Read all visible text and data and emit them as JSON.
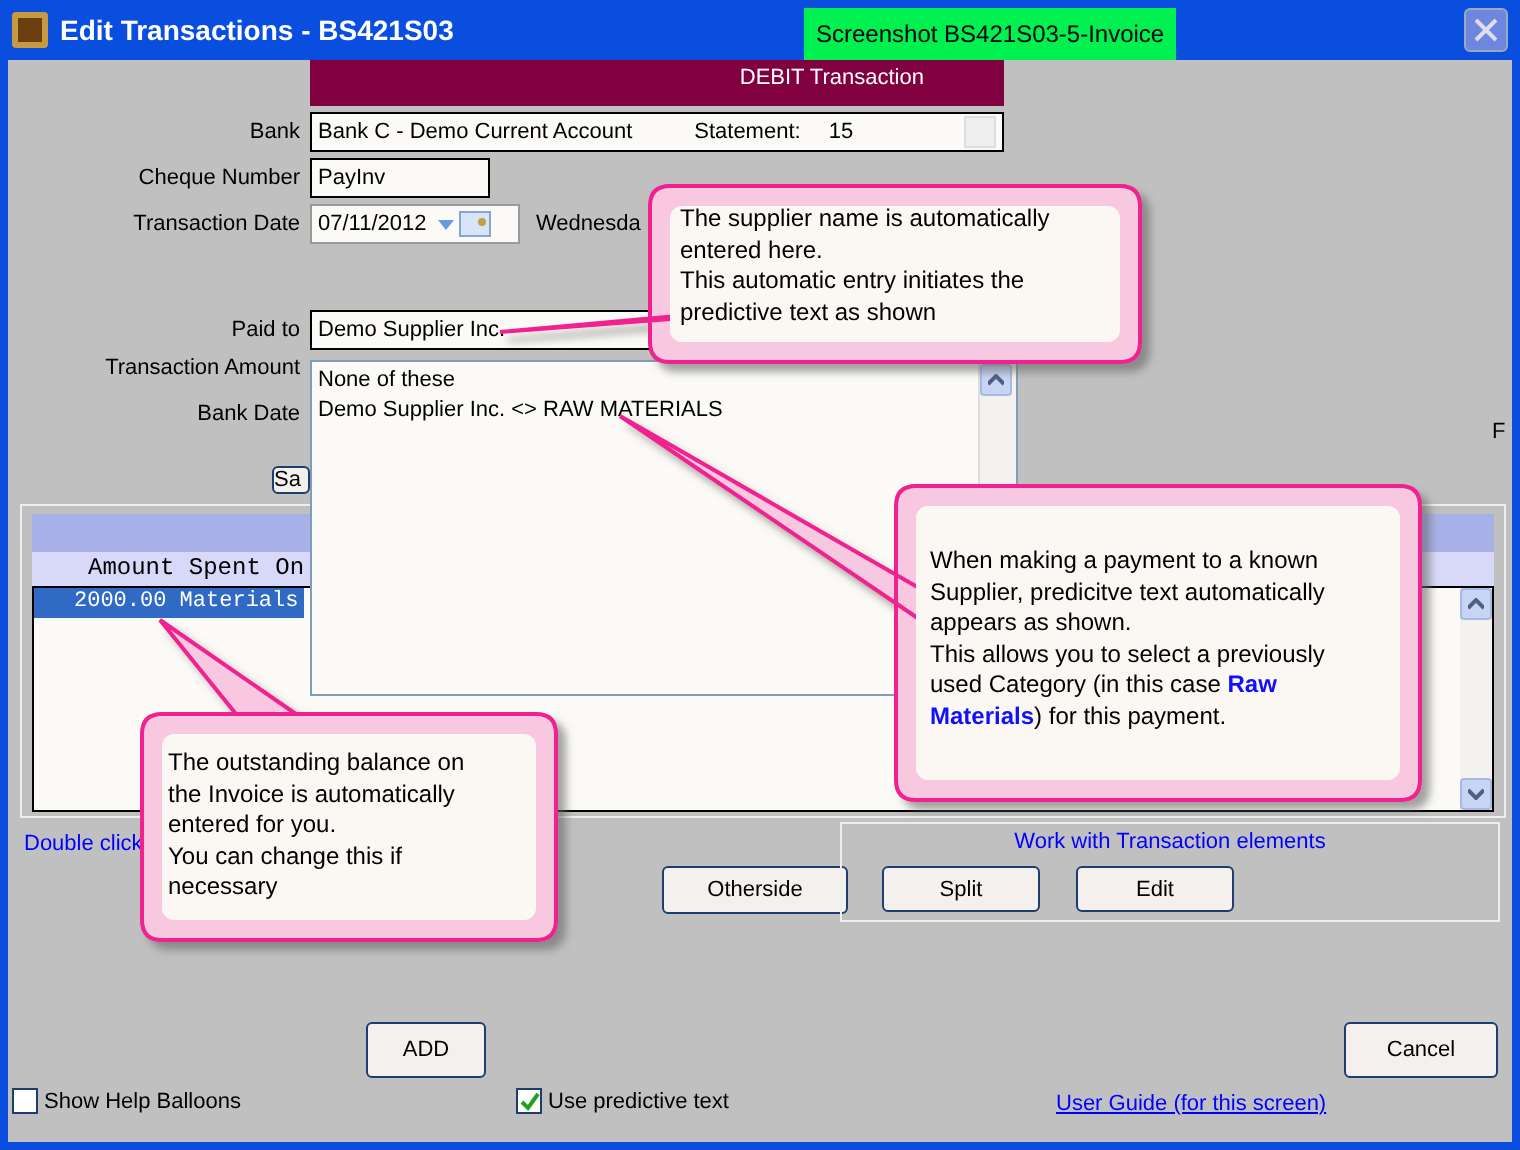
{
  "window": {
    "title": "Edit Transactions - BS421S03"
  },
  "screenshot_tag": "Screenshot BS421S03-5-Invoice",
  "banner": "DEBIT Transaction",
  "form": {
    "bank_label": "Bank",
    "bank": "Bank C - Demo Current Account",
    "statement_label": "Statement:",
    "statement": "15",
    "cheque_label": "Cheque Number",
    "cheque": "PayInv",
    "date_label": "Transaction Date",
    "date": "07/11/2012",
    "weekday": "Wednesda",
    "paid_to_label": "Paid to",
    "paid_to": "Demo Supplier Inc.",
    "amount_label": "Transaction Amount",
    "bank_date_label": "Bank Date",
    "column_3": "F",
    "save_button": "Sa"
  },
  "suggestions": [
    {
      "text": "None of these"
    },
    {
      "text": "Demo Supplier Inc. <> RAW MATERIALS"
    }
  ],
  "table": {
    "columns": [
      "Amount Spent On"
    ],
    "rows": [
      {
        "text": "2000.00 Materials",
        "selected": true
      }
    ]
  },
  "hint": "Double click",
  "otherside_button": "Otherside",
  "elements_group": {
    "title": "Work with Transaction elements",
    "buttons": [
      "Split",
      "Edit"
    ]
  },
  "add_button": "ADD",
  "cancel_button": "Cancel",
  "checkboxes": [
    {
      "label": "Show Help Balloons",
      "checked": false
    },
    {
      "label": "Use predictive text",
      "checked": true
    }
  ],
  "user_guide_link": "User Guide (for this screen)",
  "callouts": [
    {
      "text": "The supplier name is automatically entered here.\nThis automatic entry initiates the predictive text as shown"
    },
    {
      "text": "When making a payment to a known Supplier, predicitve text automatically appears as shown.\nThis allows you to select a previously used Category (in this case **Raw Materials**) for this payment."
    },
    {
      "text": "The outstanding balance on the Invoice is automatically entered for you.\nYou can change this if necessary"
    }
  ]
}
